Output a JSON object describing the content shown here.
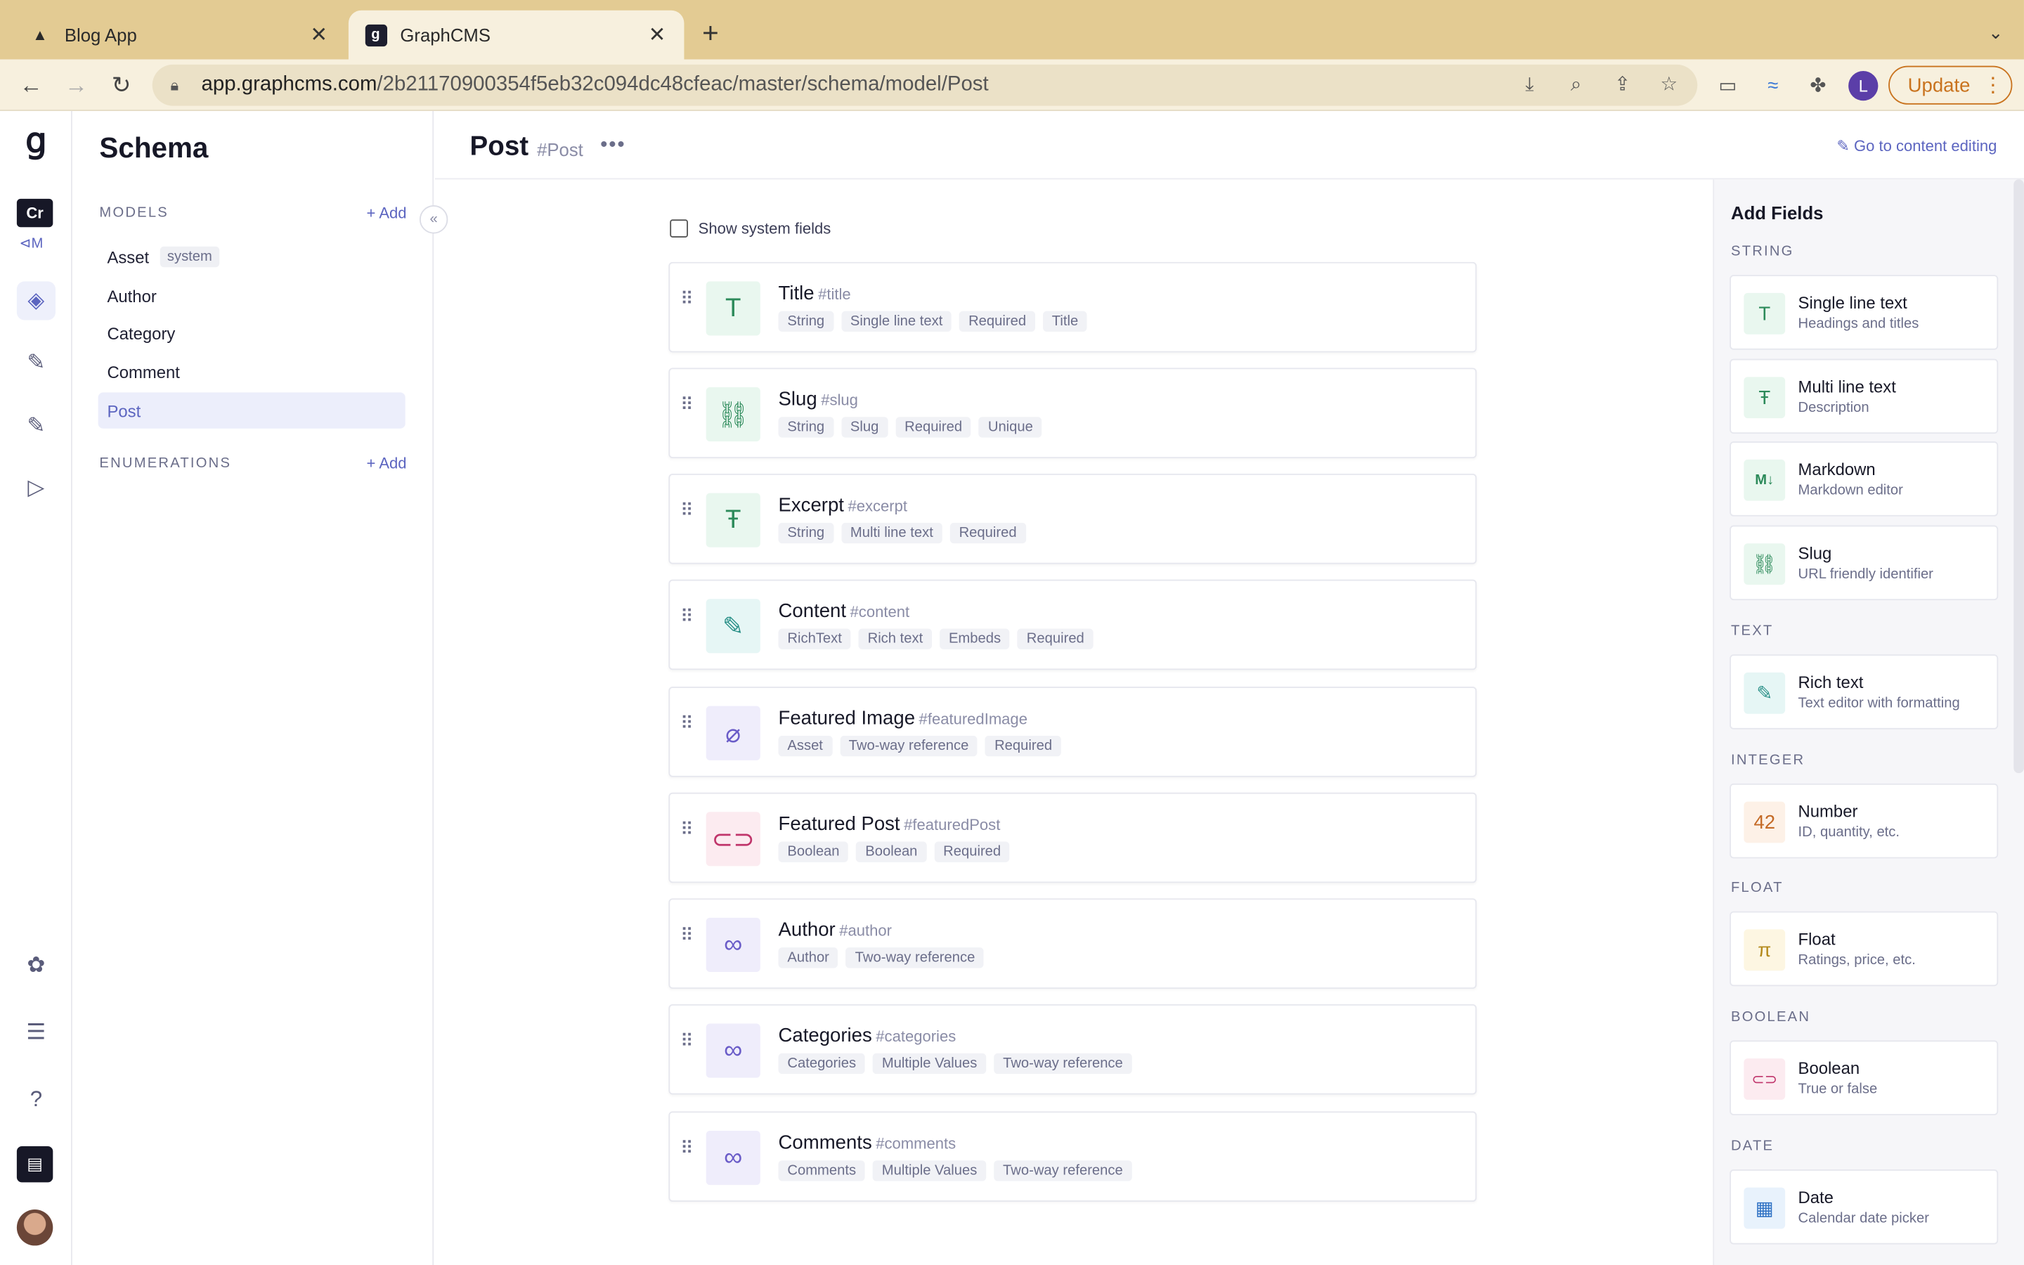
{
  "browser": {
    "tabs": [
      {
        "title": "Blog App",
        "icon": "triangle-icon"
      },
      {
        "title": "GraphCMS",
        "icon": "graphcms-logo-icon"
      }
    ],
    "url_domain": "app.graphcms.com",
    "url_path": "/2b21170900354f5eb32c094dc48cfeac/master/schema/model/Post",
    "profile_initial": "L",
    "update_label": "Update"
  },
  "rail": {
    "project_initials": "Cr",
    "project_sub": "⊲M"
  },
  "schema": {
    "title": "Schema",
    "models_label": "MODELS",
    "add_label": "Add",
    "models": [
      {
        "name": "Asset",
        "badge": "system"
      },
      {
        "name": "Author"
      },
      {
        "name": "Category"
      },
      {
        "name": "Comment"
      },
      {
        "name": "Post"
      }
    ],
    "enumerations_label": "ENUMERATIONS",
    "enum_add_label": "Add"
  },
  "main": {
    "title": "Post",
    "api_id": "#Post",
    "goto_label": "Go to content editing",
    "show_system_fields": "Show system fields",
    "fields": [
      {
        "name": "Title",
        "api": "#title",
        "icon": "text-icon",
        "tags": [
          "String",
          "Single line text",
          "Required",
          "Title"
        ]
      },
      {
        "name": "Slug",
        "api": "#slug",
        "icon": "link-icon",
        "tags": [
          "String",
          "Slug",
          "Required",
          "Unique"
        ]
      },
      {
        "name": "Excerpt",
        "api": "#excerpt",
        "icon": "multiline-icon",
        "tags": [
          "String",
          "Multi line text",
          "Required"
        ]
      },
      {
        "name": "Content",
        "api": "#content",
        "icon": "rich-text-icon",
        "tags": [
          "RichText",
          "Rich text",
          "Embeds",
          "Required"
        ]
      },
      {
        "name": "Featured Image",
        "api": "#featuredImage",
        "icon": "paperclip-icon",
        "tags": [
          "Asset",
          "Two-way reference",
          "Required"
        ]
      },
      {
        "name": "Featured Post",
        "api": "#featuredPost",
        "icon": "toggle-icon",
        "tags": [
          "Boolean",
          "Boolean",
          "Required"
        ]
      },
      {
        "name": "Author",
        "api": "#author",
        "icon": "reference-icon",
        "tags": [
          "Author",
          "Two-way reference"
        ]
      },
      {
        "name": "Categories",
        "api": "#categories",
        "icon": "reference-icon",
        "tags": [
          "Categories",
          "Multiple Values",
          "Two-way reference"
        ]
      },
      {
        "name": "Comments",
        "api": "#comments",
        "icon": "reference-icon",
        "tags": [
          "Comments",
          "Multiple Values",
          "Two-way reference"
        ]
      }
    ]
  },
  "add_fields": {
    "title": "Add Fields",
    "categories": [
      {
        "label": "STRING",
        "types": [
          {
            "name": "Single line text",
            "desc": "Headings and titles",
            "icon": "text-icon"
          },
          {
            "name": "Multi line text",
            "desc": "Description",
            "icon": "multiline-icon"
          },
          {
            "name": "Markdown",
            "desc": "Markdown editor",
            "icon": "markdown-icon"
          },
          {
            "name": "Slug",
            "desc": "URL friendly identifier",
            "icon": "link-icon"
          }
        ]
      },
      {
        "label": "TEXT",
        "types": [
          {
            "name": "Rich text",
            "desc": "Text editor with formatting",
            "icon": "rich-text-icon"
          }
        ]
      },
      {
        "label": "INTEGER",
        "types": [
          {
            "name": "Number",
            "desc": "ID, quantity, etc.",
            "icon": "number-icon"
          }
        ]
      },
      {
        "label": "FLOAT",
        "types": [
          {
            "name": "Float",
            "desc": "Ratings, price, etc.",
            "icon": "pi-icon"
          }
        ]
      },
      {
        "label": "BOOLEAN",
        "types": [
          {
            "name": "Boolean",
            "desc": "True or false",
            "icon": "toggle-icon"
          }
        ]
      },
      {
        "label": "DATE",
        "types": [
          {
            "name": "Date",
            "desc": "Calendar date picker",
            "icon": "calendar-icon"
          }
        ]
      }
    ]
  }
}
